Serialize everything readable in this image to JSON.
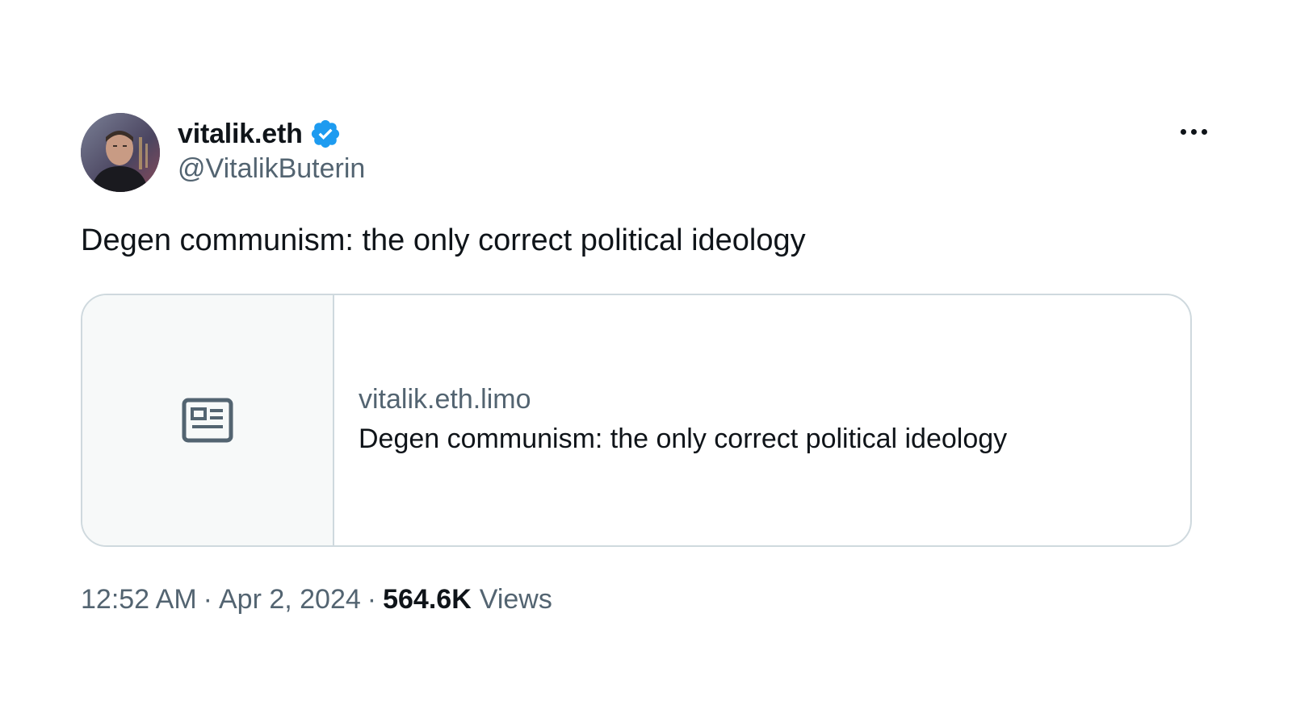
{
  "author": {
    "display_name": "vitalik.eth",
    "handle": "@VitalikButerin",
    "verified": true,
    "verified_color": "#1d9bf0"
  },
  "tweet": {
    "text": "Degen communism: the only correct political ideology"
  },
  "link_card": {
    "domain": "vitalik.eth.limo",
    "title": "Degen communism: the only correct political ideology",
    "thumbnail_icon": "article-icon"
  },
  "meta": {
    "time": "12:52 AM",
    "separator": "·",
    "date": "Apr 2, 2024",
    "views_count": "564.6K",
    "views_label": "Views"
  },
  "colors": {
    "text_primary": "#0f1419",
    "text_secondary": "#536471",
    "border": "#cfd9de",
    "card_thumb_bg": "#f7f9f9"
  }
}
